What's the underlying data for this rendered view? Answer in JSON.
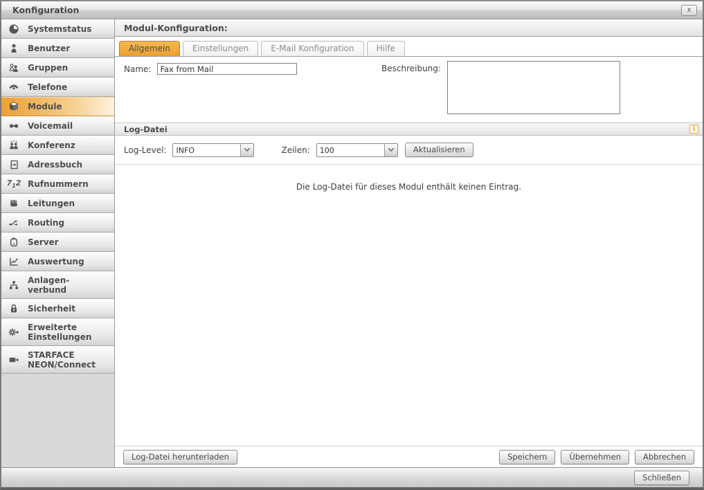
{
  "window": {
    "title": "Konfiguration",
    "close_label": "x"
  },
  "sidebar": {
    "items": [
      {
        "label": "Systemstatus",
        "icon": "clock-icon"
      },
      {
        "label": "Benutzer",
        "icon": "user-icon"
      },
      {
        "label": "Gruppen",
        "icon": "users-icon"
      },
      {
        "label": "Telefone",
        "icon": "phone-icon"
      },
      {
        "label": "Module",
        "icon": "cube-icon",
        "active": true
      },
      {
        "label": "Voicemail",
        "icon": "voicemail-icon"
      },
      {
        "label": "Konferenz",
        "icon": "conference-icon"
      },
      {
        "label": "Adressbuch",
        "icon": "address-book-icon"
      },
      {
        "label": "Rufnummern",
        "icon": "numbers-icon"
      },
      {
        "label": "Leitungen",
        "icon": "lines-icon"
      },
      {
        "label": "Routing",
        "icon": "routing-icon"
      },
      {
        "label": "Server",
        "icon": "server-icon"
      },
      {
        "label": "Auswertung",
        "icon": "chart-icon"
      },
      {
        "label": "Anlagen-\nverbund",
        "icon": "network-icon"
      },
      {
        "label": "Sicherheit",
        "icon": "lock-icon"
      },
      {
        "label": "Erweiterte\nEinstellungen",
        "icon": "gear-plus-icon"
      },
      {
        "label": "STARFACE\nNEON/Connect",
        "icon": "video-camera-icon"
      }
    ]
  },
  "main": {
    "header": "Modul-Konfiguration:",
    "tabs": [
      {
        "label": "Allgemein",
        "active": true
      },
      {
        "label": "Einstellungen",
        "active": false
      },
      {
        "label": "E-Mail Konfiguration",
        "active": false
      },
      {
        "label": "Hilfe",
        "active": false
      }
    ],
    "form": {
      "name_label": "Name:",
      "name_value": "Fax from Mail",
      "description_label": "Beschreibung:",
      "description_value": ""
    },
    "log": {
      "section_title": "Log-Datei",
      "info_icon_glyph": "i",
      "level_label": "Log-Level:",
      "level_value": "INFO",
      "lines_label": "Zeilen:",
      "lines_value": "100",
      "refresh_button": "Aktualisieren",
      "empty_message": "Die Log-Datei für dieses Modul enthält keinen Eintrag."
    },
    "footer": {
      "download_button": "Log-Datei herunterladen",
      "save_button": "Speichern",
      "apply_button": "Übernehmen",
      "cancel_button": "Abbrechen"
    }
  },
  "bottombar": {
    "close_button": "Schließen"
  },
  "colors": {
    "accent_orange": "#EFA23B",
    "active_tab_border": "#A8813C",
    "info_icon_orange": "#E8A33D",
    "text_dark": "#4D4D4D"
  }
}
